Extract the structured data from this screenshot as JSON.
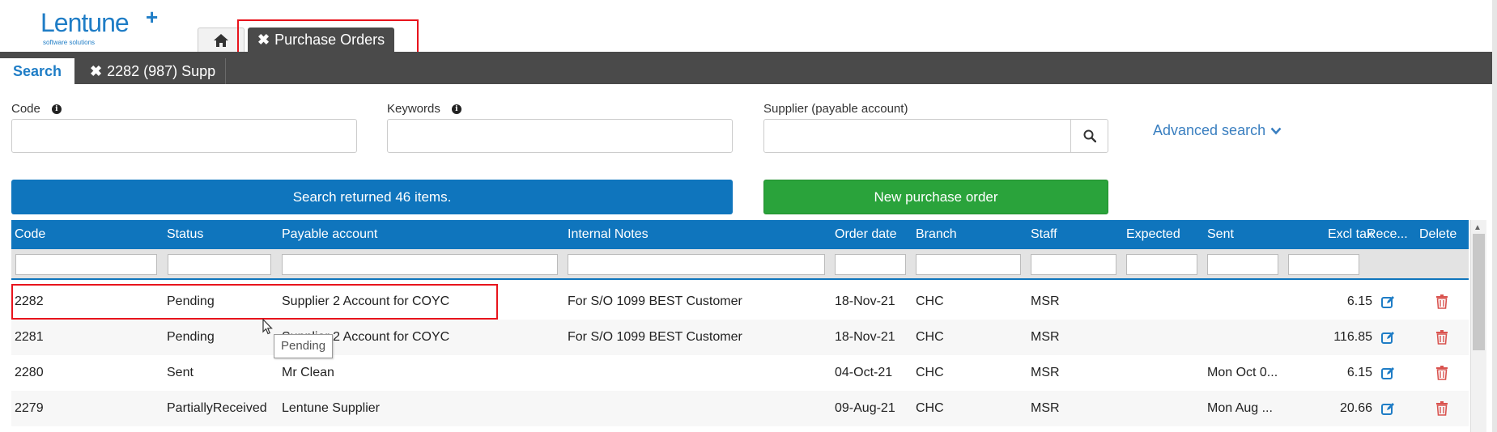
{
  "logo": {
    "name": "Lentune",
    "plus": "+",
    "tagline": "software solutions"
  },
  "top_tabs": {
    "home_icon": "home-icon",
    "purchase_orders": "Purchase Orders",
    "close_glyph": "✖"
  },
  "subtabs": {
    "search": "Search",
    "record": "2282 (987) Supp",
    "close_glyph": "✖"
  },
  "filters": {
    "code_label": "Code",
    "keywords_label": "Keywords",
    "supplier_label": "Supplier (payable account)",
    "code_value": "",
    "keywords_value": "",
    "supplier_value": "",
    "advanced_search": "Advanced search"
  },
  "buttons": {
    "result": "Search returned 46 items.",
    "new_po": "New purchase order"
  },
  "table": {
    "columns": [
      "Code",
      "Status",
      "Payable account",
      "Internal Notes",
      "Order date",
      "Branch",
      "Staff",
      "Expected",
      "Sent",
      "Excl tax",
      "Rece...",
      "Delete"
    ],
    "rows": [
      {
        "code": "2282",
        "status": "Pending",
        "payable": "Supplier 2 Account for COYC",
        "notes": "For S/O 1099 BEST Customer",
        "order_date": "18-Nov-21",
        "branch": "CHC",
        "staff": "MSR",
        "expected": "",
        "sent": "",
        "excl_tax": "6.15"
      },
      {
        "code": "2281",
        "status": "Pending",
        "payable": "Supplier 2 Account for COYC",
        "notes": "For S/O 1099 BEST Customer",
        "order_date": "18-Nov-21",
        "branch": "CHC",
        "staff": "MSR",
        "expected": "",
        "sent": "",
        "excl_tax": "116.85"
      },
      {
        "code": "2280",
        "status": "Sent",
        "payable": "Mr Clean",
        "notes": "",
        "order_date": "04-Oct-21",
        "branch": "CHC",
        "staff": "MSR",
        "expected": "",
        "sent": "Mon Oct 0...",
        "excl_tax": "6.15"
      },
      {
        "code": "2279",
        "status": "PartiallyReceived",
        "payable": "Lentune Supplier",
        "notes": "",
        "order_date": "09-Aug-21",
        "branch": "CHC",
        "staff": "MSR",
        "expected": "",
        "sent": "Mon Aug ...",
        "excl_tax": "20.66"
      }
    ]
  },
  "tooltip": "Pending",
  "colors": {
    "primary": "#0f75bd",
    "success": "#2aa33b",
    "dark_bar": "#4a4a4a",
    "highlight": "#e8141c",
    "danger": "#d9534f"
  }
}
